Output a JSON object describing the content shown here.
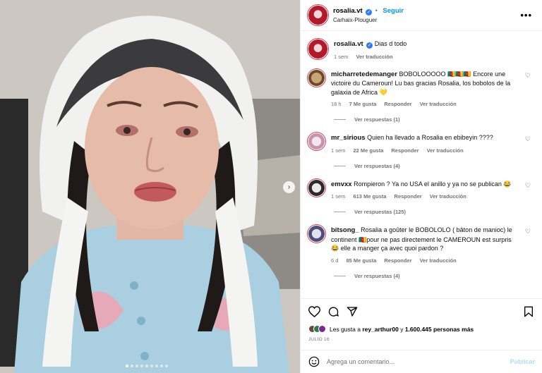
{
  "post": {
    "username": "rosalia.vt",
    "follow_label": "Seguir",
    "location": "Carhaix-Plouguer",
    "more_label": "•••"
  },
  "caption": {
    "username": "rosalia.vt",
    "text": "Dias d todo",
    "time": "1 sem",
    "translate_label": "Ver traducción"
  },
  "comments": [
    {
      "username": "micharretedemanger",
      "text": "BOBOLOOOOO 🇨🇲🇨🇲🇨🇲 Encore une victoire du Cameroun! Lu bas gracias Rosalia, los bobolos de la galaxia de Africa 💛",
      "time": "18 h",
      "likes": "7 Me gusta",
      "reply": "Responder",
      "translate": "Ver traducción",
      "replies": "Ver respuestas (1)"
    },
    {
      "username": "mr_sirious",
      "text": "Quien ha llevado a Rosalia en ebibeyin ????",
      "time": "1 sem",
      "likes": "22 Me gusta",
      "reply": "Responder",
      "translate": "Ver traducción",
      "replies": "Ver respuestas (4)"
    },
    {
      "username": "emvxx",
      "text": "Rompieron ? Ya no USA el anillo y ya no se publican 😂",
      "time": "1 sem",
      "likes": "613 Me gusta",
      "reply": "Responder",
      "translate": "Ver traducción",
      "replies": "Ver respuestas (125)"
    },
    {
      "username": "bitsong_",
      "text": "Rosalia a goûter le BOBOLOLO ( bâton de manioc) le continent 🇨🇲pour ne pas directement le CAMEROUN est surpris 😂 elle a manger ça avec quoi pardon ?",
      "time": "6 d",
      "likes": "85 Me gusta",
      "reply": "Responder",
      "translate": "Ver traducción",
      "replies": "Ver respuestas (4)"
    }
  ],
  "likes": {
    "prefix": "Les gusta a ",
    "user": "rey_arthur00",
    "middle": " y ",
    "count": "1.600.445 personas más"
  },
  "date": "JULIO 16",
  "add_comment": {
    "placeholder": "Agrega un comentario...",
    "publish_label": "Publicar"
  },
  "carousel": {
    "current": 1,
    "total": 9
  }
}
